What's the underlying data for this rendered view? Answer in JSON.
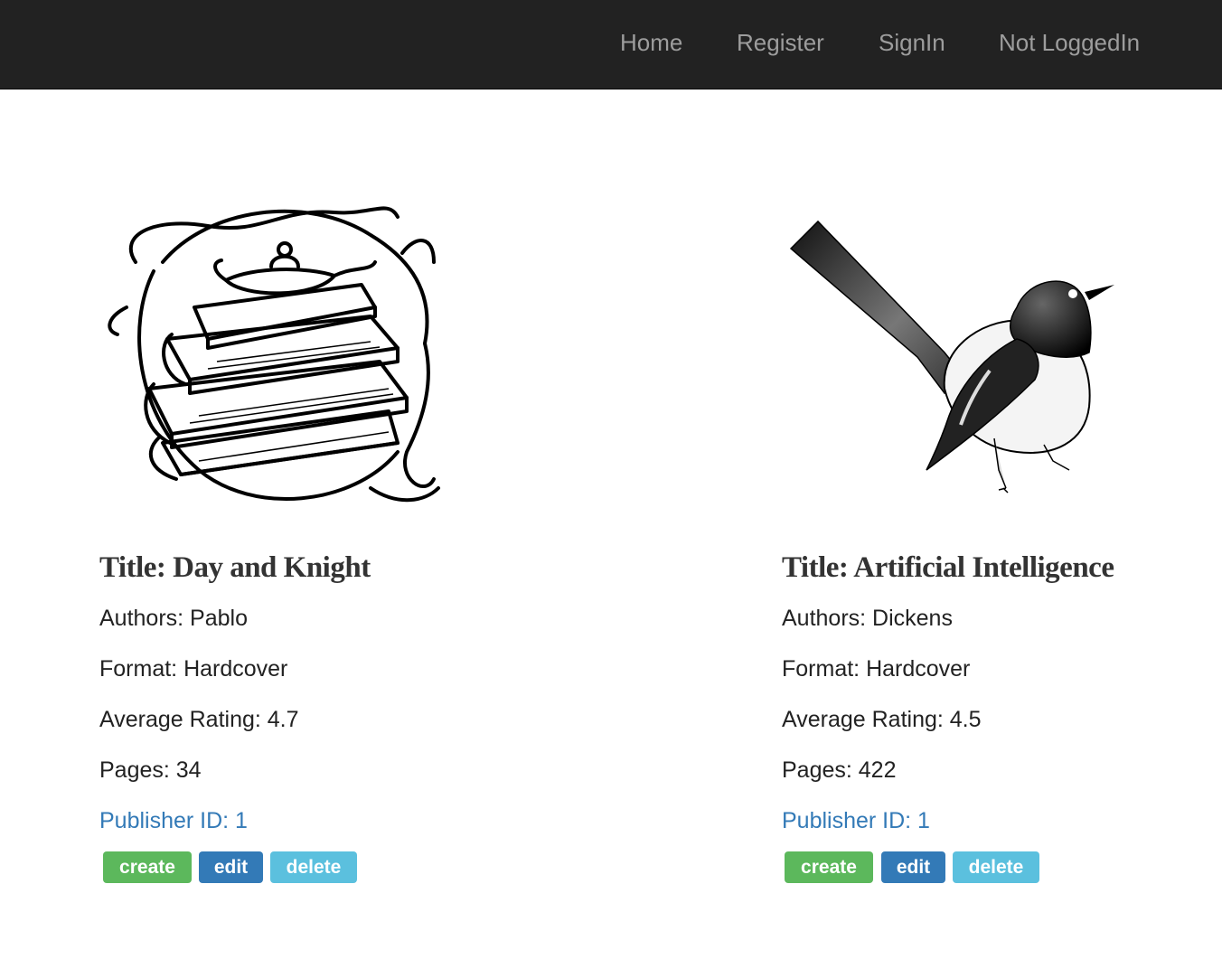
{
  "nav": {
    "home": "Home",
    "register": "Register",
    "signin": "SignIn",
    "status": "Not LoggedIn"
  },
  "books": [
    {
      "image": "books-and-lamp-illustration",
      "title": "Title: Day and Knight",
      "authors": "Authors: Pablo",
      "format": "Format: Hardcover",
      "rating": "Average Rating: 4.7",
      "pages": "Pages: 34",
      "publisher": "Publisher ID: 1"
    },
    {
      "image": "magpie-bird-illustration",
      "title": "Title: Artificial Intelligence",
      "authors": "Authors: Dickens",
      "format": "Format: Hardcover",
      "rating": "Average Rating: 4.5",
      "pages": "Pages: 422",
      "publisher": "Publisher ID: 1"
    }
  ],
  "buttons": {
    "create": "create",
    "edit": "edit",
    "delete": "delete"
  },
  "colors": {
    "navbar": "#222222",
    "nav_text": "#9d9d9d",
    "link": "#337ab7",
    "create": "#5cb85c",
    "edit": "#337ab7",
    "delete": "#5bc0de"
  }
}
